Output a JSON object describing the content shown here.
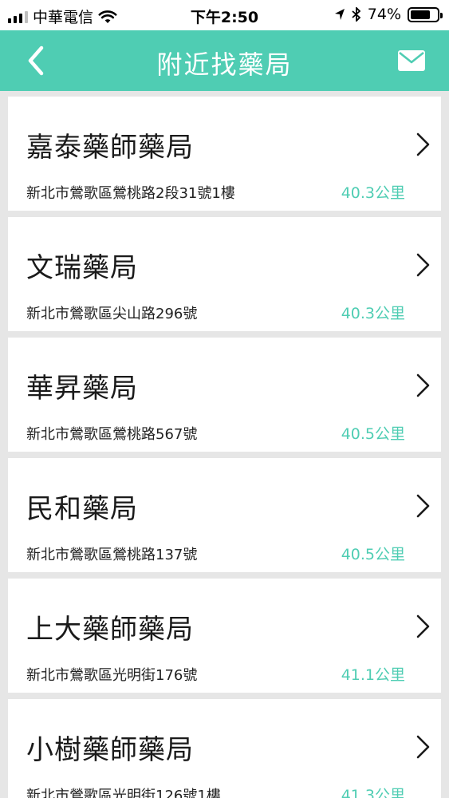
{
  "status_bar": {
    "carrier": "中華電信",
    "time": "下午2:50",
    "battery": "74%",
    "battery_level": 0.74
  },
  "nav": {
    "title": "附近找藥局",
    "icons": {
      "back": "back-chevron-icon",
      "mail": "mail-icon"
    },
    "accent_color": "#4fcdb3"
  },
  "pharmacies": [
    {
      "name": "嘉泰藥師藥局",
      "address": "新北市鶯歌區鶯桃路2段31號1樓",
      "distance": "40.3公里"
    },
    {
      "name": "文瑞藥局",
      "address": "新北市鶯歌區尖山路296號",
      "distance": "40.3公里"
    },
    {
      "name": "華昇藥局",
      "address": "新北市鶯歌區鶯桃路567號",
      "distance": "40.5公里"
    },
    {
      "name": "民和藥局",
      "address": "新北市鶯歌區鶯桃路137號",
      "distance": "40.5公里"
    },
    {
      "name": "上大藥師藥局",
      "address": "新北市鶯歌區光明街176號",
      "distance": "41.1公里"
    },
    {
      "name": "小樹藥師藥局",
      "address": "新北市鶯歌區光明街126號1樓",
      "distance": "41.3公里"
    }
  ]
}
